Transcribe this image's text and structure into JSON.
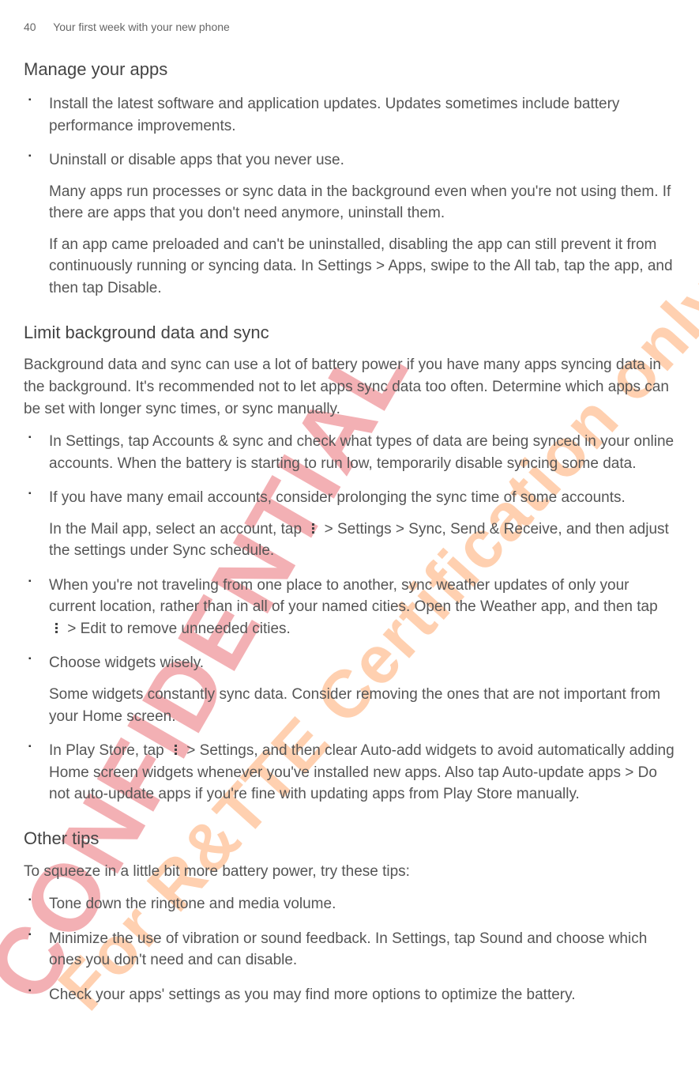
{
  "header": {
    "page_number": "40",
    "chapter_title": "Your first week with your new phone"
  },
  "watermarks": {
    "confidential": "CONFIDENTIAL",
    "certification": "For R&TTE Certification only"
  },
  "icons": {
    "more": "more-options-icon"
  },
  "sections": [
    {
      "heading": "Manage your apps",
      "intro": "",
      "items": [
        {
          "paragraphs": [
            "Install the latest software and application updates. Updates sometimes include battery performance improvements."
          ]
        },
        {
          "paragraphs": [
            "Uninstall or disable apps that you never use.",
            "Many apps run processes or sync data in the background even when you're not using them. If there are apps that you don't need anymore, uninstall them.",
            "If an app came preloaded and can't be uninstalled, disabling the app can still prevent it from continuously running or syncing data. In Settings > Apps, swipe to the All tab, tap the app, and then tap Disable."
          ]
        }
      ]
    },
    {
      "heading": "Limit background data and sync",
      "intro": "Background data and sync can use a lot of battery power if you have many apps syncing data in the background. It's recommended not to let apps sync data too often. Determine which apps can be set with longer sync times, or sync manually.",
      "items": [
        {
          "paragraphs": [
            "In Settings, tap Accounts & sync and check what types of data are being synced in your online accounts. When the battery is starting to run low, temporarily disable syncing some data."
          ]
        },
        {
          "paragraphs": [
            "If you have many email accounts, consider prolonging the sync time of some accounts.",
            "In the Mail app, select an account, tap {more} > Settings > Sync, Send & Receive, and then adjust the settings under Sync schedule."
          ]
        },
        {
          "paragraphs": [
            "When you're not traveling from one place to another, sync weather updates of only your current location, rather than in all of your named cities. Open the Weather app, and then tap {more} > Edit to remove unneeded cities."
          ]
        },
        {
          "paragraphs": [
            "Choose widgets wisely.",
            "Some widgets constantly sync data. Consider removing the ones that are not important from your Home screen."
          ]
        },
        {
          "paragraphs": [
            "In Play Store, tap {more} > Settings, and then clear Auto-add widgets to avoid automatically adding Home screen widgets whenever you've installed new apps. Also tap Auto-update apps > Do not auto-update apps if you're fine with updating apps from Play Store manually."
          ]
        }
      ]
    },
    {
      "heading": "Other tips",
      "intro": "To squeeze in a little bit more battery power, try these tips:",
      "items": [
        {
          "paragraphs": [
            "Tone down the ringtone and media volume."
          ]
        },
        {
          "paragraphs": [
            "Minimize the use of vibration or sound feedback. In Settings, tap Sound and choose which ones you don't need and can disable."
          ]
        },
        {
          "paragraphs": [
            "Check your apps' settings as you may find more options to optimize the battery."
          ]
        }
      ]
    }
  ]
}
